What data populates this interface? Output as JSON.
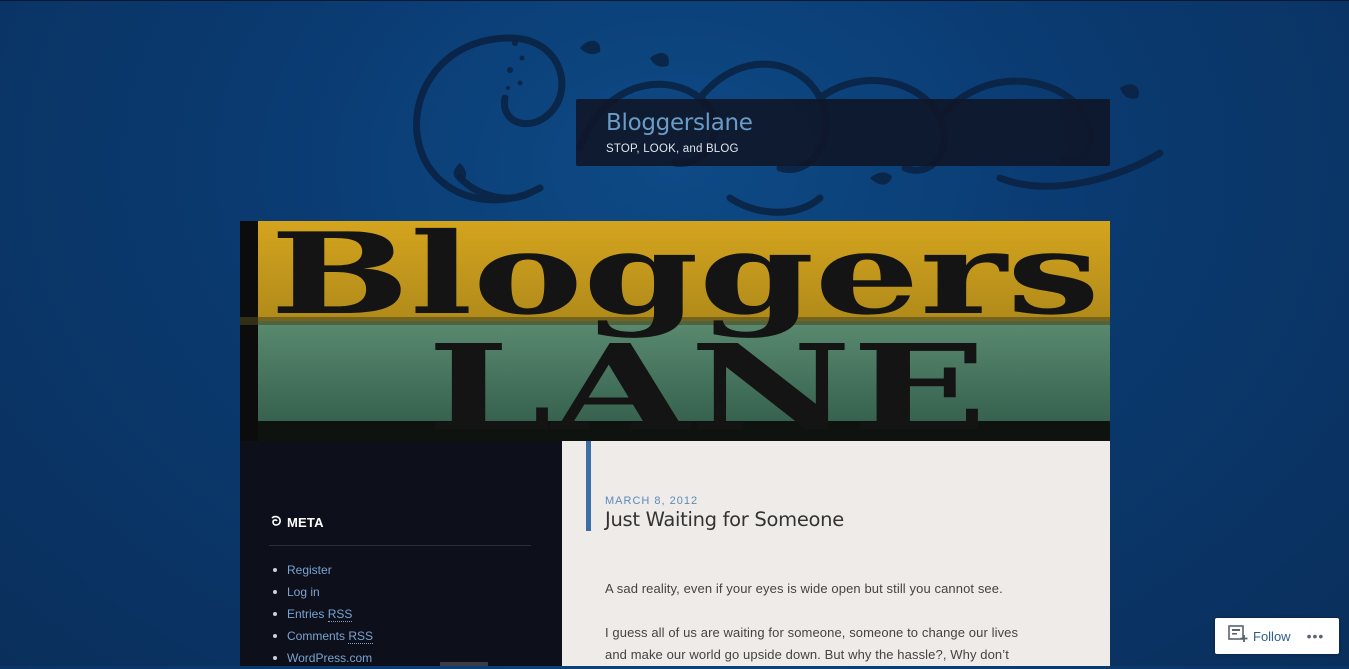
{
  "header": {
    "site_title": "Bloggerslane",
    "site_description": "STOP, LOOK, and BLOG"
  },
  "banner": {
    "line1": "Bloggers",
    "line2": "LANE"
  },
  "sidebar": {
    "widget_title": "META",
    "items": [
      {
        "label": "Register"
      },
      {
        "label": "Log in"
      },
      {
        "label_prefix": "Entries ",
        "abbr": "RSS"
      },
      {
        "label_prefix": "Comments ",
        "abbr": "RSS"
      },
      {
        "label": "WordPress.com"
      }
    ]
  },
  "post": {
    "date": "MARCH 8, 2012",
    "title": "Just Waiting for Someone",
    "paragraphs": [
      "A sad reality, even if your eyes is wide open but still you cannot see.",
      "I guess all of us are waiting for someone, someone to change our lives",
      "and make our world go upside down. But why the hassle?, Why don’t"
    ]
  },
  "follow": {
    "label": "Follow",
    "icon": "follow-reader-icon",
    "more_icon": "ellipsis-icon"
  },
  "colors": {
    "background": "#0a3a70",
    "header_box": "#0e1628",
    "link": "#7aa3d0",
    "accent": "#3b6ea5",
    "content_bg": "#efebe8",
    "sidebar_bg": "#0d0f1a"
  }
}
